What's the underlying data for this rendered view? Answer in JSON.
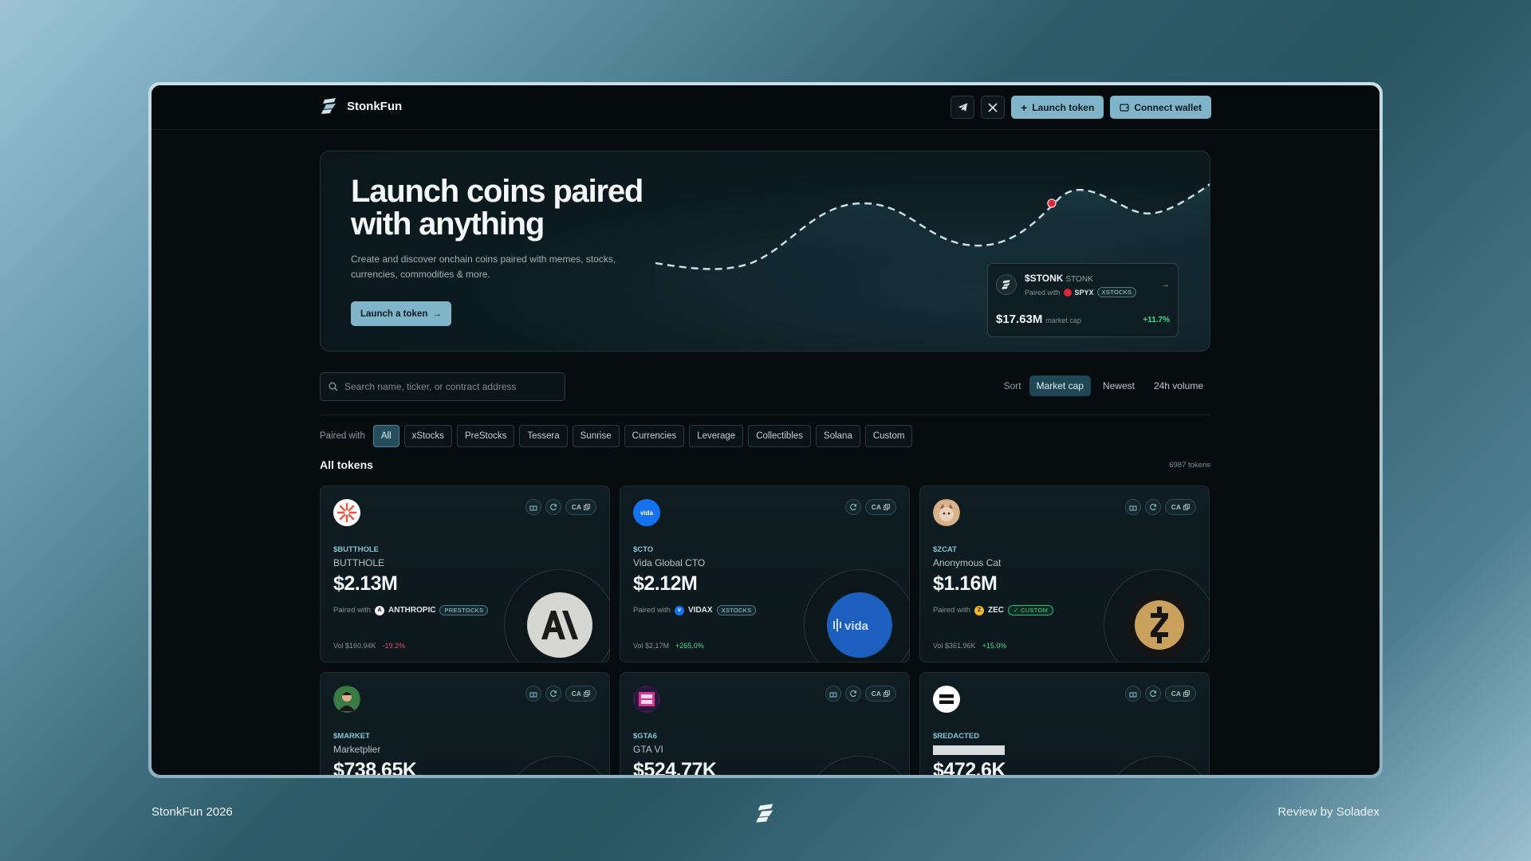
{
  "brand": {
    "name": "StonkFun"
  },
  "nav": {
    "launch_label": "Launch token",
    "connect_label": "Connect wallet"
  },
  "hero": {
    "title": "Launch coins paired with anything",
    "subtitle": "Create and discover onchain coins paired with memes, stocks, currencies, commodities & more.",
    "cta_label": "Launch a token",
    "featured": {
      "name": "$STONK",
      "ticker": "STONK",
      "paired_label": "Paired with",
      "paired_symbol": "SPYX",
      "tag": "XSTOCKS",
      "market_cap": "$17.63M",
      "market_cap_label": "market cap",
      "change": "+11.7%"
    }
  },
  "search": {
    "placeholder": "Search name, ticker, or contract address"
  },
  "sort": {
    "label": "Sort",
    "options": [
      "Market cap",
      "Newest",
      "24h volume"
    ],
    "active": "Market cap"
  },
  "filters": {
    "label": "Paired with",
    "options": [
      "All",
      "xStocks",
      "PreStocks",
      "Tessera",
      "Sunrise",
      "Currencies",
      "Leverage",
      "Collectibles",
      "Solana",
      "Custom"
    ],
    "active": "All"
  },
  "list": {
    "title": "All tokens",
    "count": "6987 tokens"
  },
  "tokens": [
    {
      "ticker": "$BUTTHOLE",
      "name": "BUTTHOLE",
      "cap": "$2.13M",
      "paired_label": "Paired with",
      "paired": "ANTHROPIC",
      "tag": "PRESTOCKS",
      "vol": "Vol $160.94K",
      "change": "-19.2%",
      "ca": "CA"
    },
    {
      "ticker": "$CTO",
      "name": "Vida Global CTO",
      "cap": "$2.12M",
      "paired_label": "Paired with",
      "paired": "VIDAX",
      "tag": "XSTOCKS",
      "vol": "Vol $2.17M",
      "change": "+265.0%",
      "ca": "CA"
    },
    {
      "ticker": "$ZCAT",
      "name": "Anonymous Cat",
      "cap": "$1.16M",
      "paired_label": "Paired with",
      "paired": "ZEC",
      "tag": "CUSTOM",
      "vol": "Vol $361.96K",
      "change": "+15.0%",
      "ca": "CA"
    },
    {
      "ticker": "$MARKET",
      "name": "Marketplier",
      "cap": "$738.65K",
      "ca": "CA"
    },
    {
      "ticker": "$GTA6",
      "name": "GTA VI",
      "cap": "$524.77K",
      "ca": "CA"
    },
    {
      "ticker": "$REDACTED",
      "name": "",
      "cap": "$472.6K",
      "ca": "CA"
    }
  ],
  "footer": {
    "left": "StonkFun 2026",
    "right": "Review by Soladex"
  },
  "colors": {
    "accent": "#7fb4c9",
    "positive": "#3ddc97",
    "negative": "#e0486a",
    "background": "#070d0f"
  }
}
